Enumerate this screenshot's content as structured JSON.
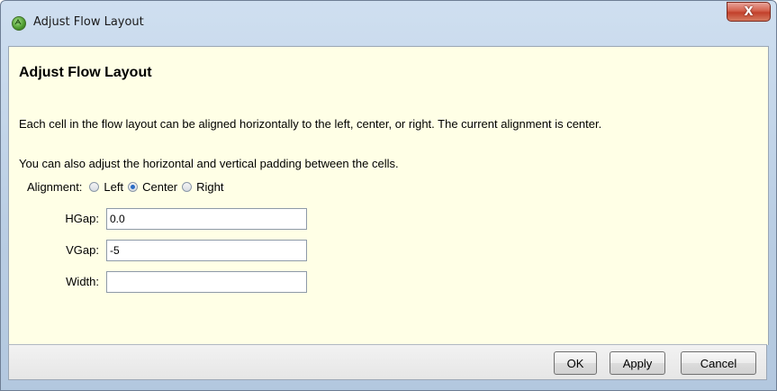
{
  "window": {
    "title": "Adjust Flow Layout",
    "close_label": "X"
  },
  "content": {
    "heading": "Adjust Flow Layout",
    "paragraph1": "Each cell in the flow layout can be aligned horizontally to the left, center, or right. The current alignment is center.",
    "paragraph2": "You can also adjust the horizontal and vertical padding between the cells.",
    "alignment": {
      "label": "Alignment:",
      "options": [
        "Left",
        "Center",
        "Right"
      ],
      "selected": "Center"
    },
    "fields": {
      "hgap_label": "HGap:",
      "hgap_value": "0.0",
      "vgap_label": "VGap:",
      "vgap_value": "-5",
      "width_label": "Width:",
      "width_value": ""
    }
  },
  "buttons": {
    "ok": "OK",
    "apply": "Apply",
    "cancel": "Cancel"
  },
  "colors": {
    "content_background": "#ffffe6",
    "close_button": "#c2402b"
  }
}
